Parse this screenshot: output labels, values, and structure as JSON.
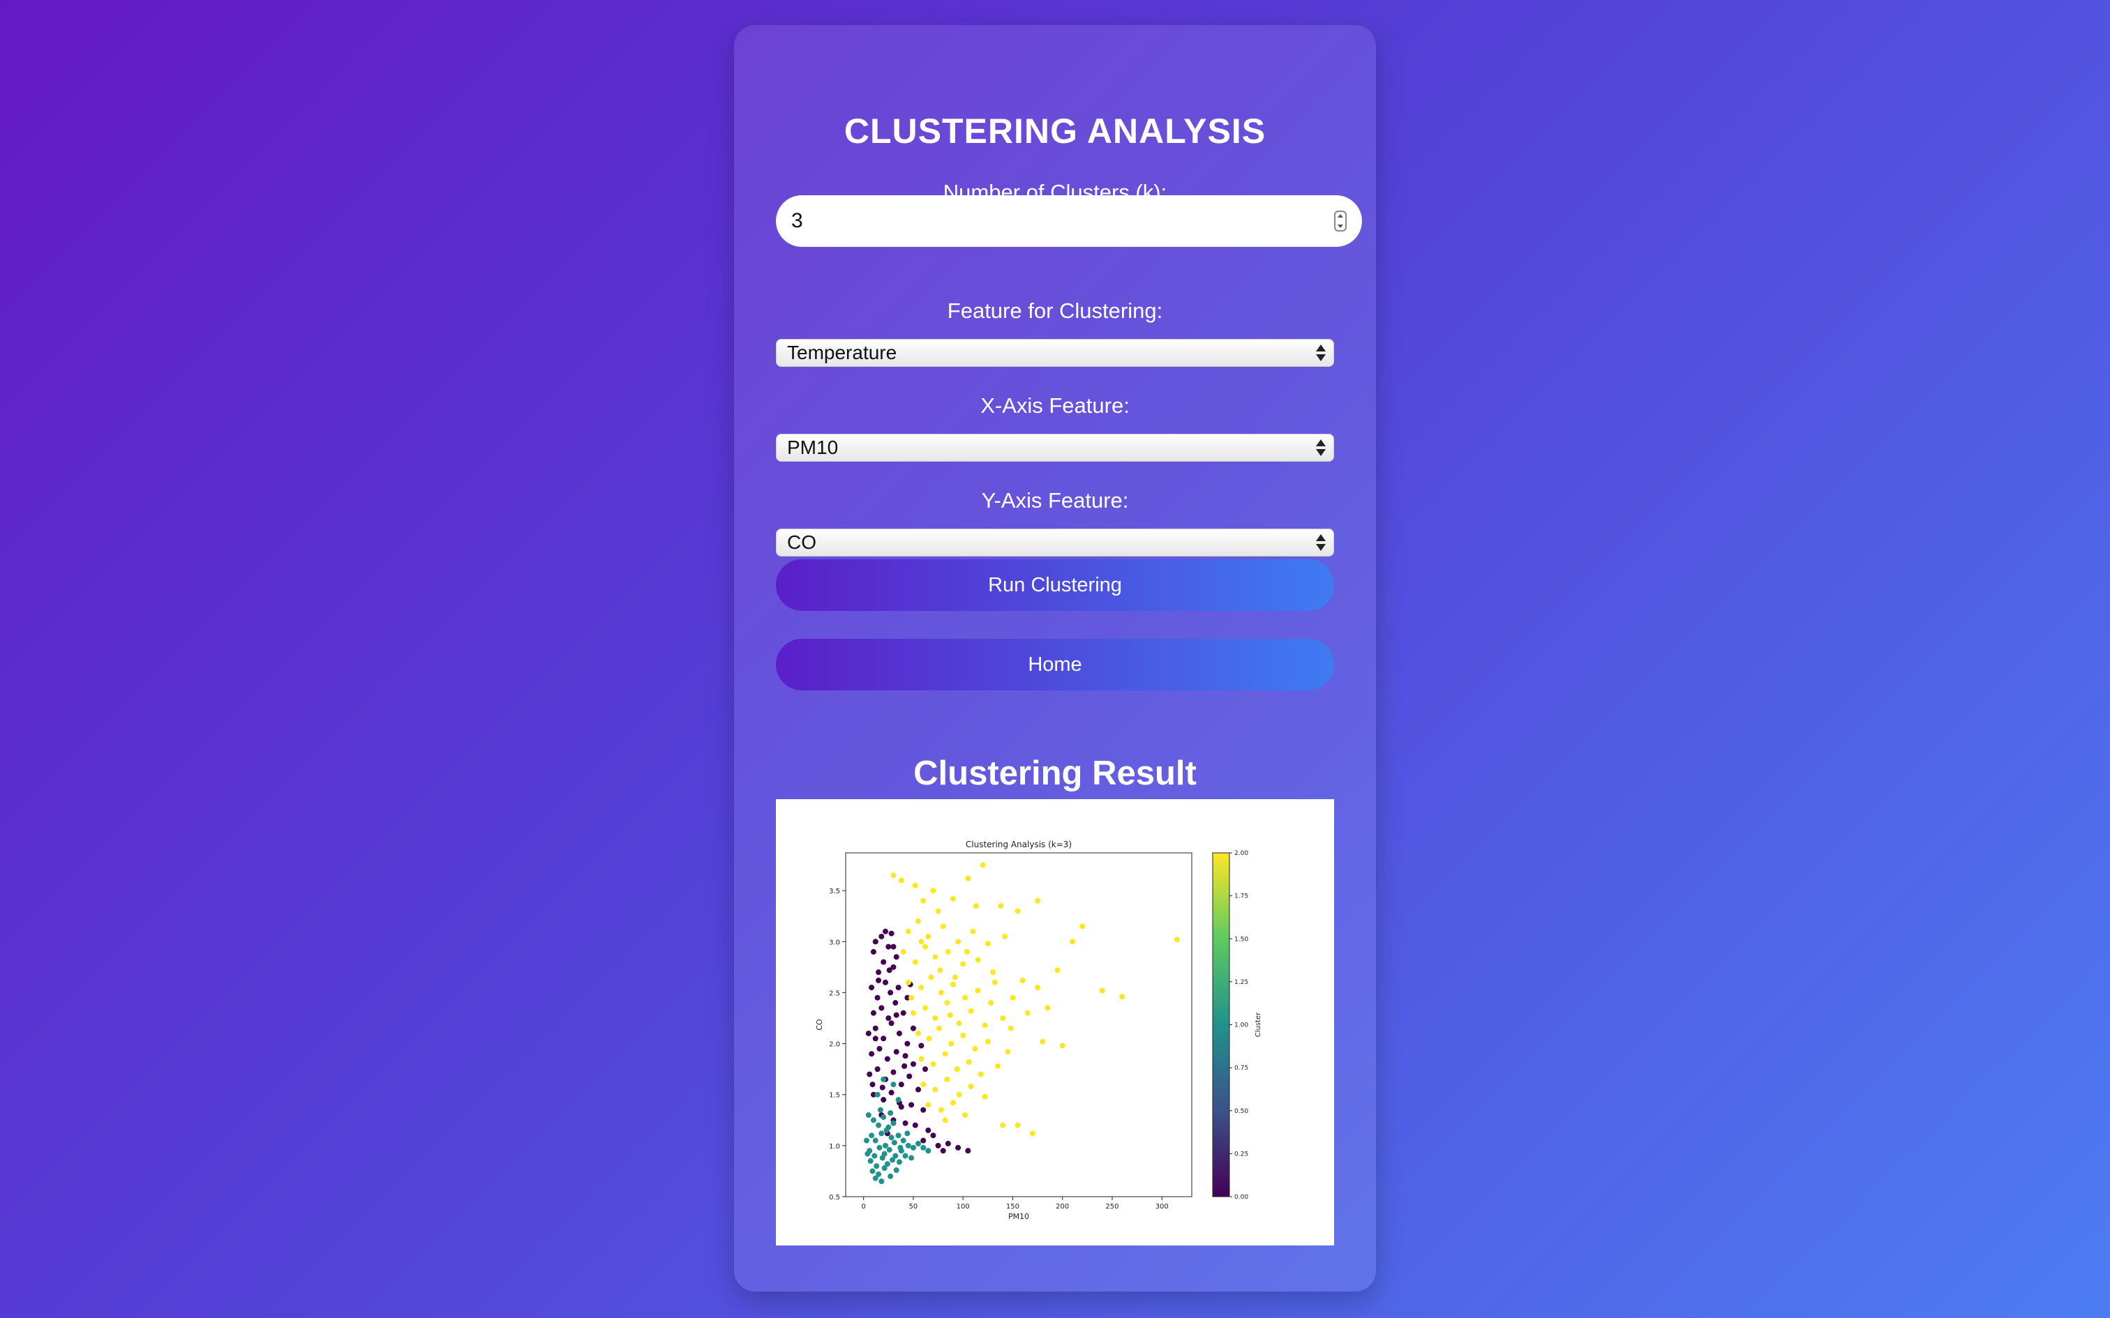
{
  "form": {
    "title": "CLUSTERING ANALYSIS",
    "k_label": "Number of Clusters (k):",
    "k_value": "3",
    "feature_label": "Feature for Clustering:",
    "feature_value": "Temperature",
    "x_label": "X-Axis Feature:",
    "x_value": "PM10",
    "y_label": "Y-Axis Feature:",
    "y_value": "CO",
    "run_button": "Run Clustering",
    "home_button": "Home"
  },
  "result": {
    "title": "Clustering Result"
  },
  "chart_data": {
    "type": "scatter",
    "title": "Clustering Analysis (k=3)",
    "xlabel": "PM10",
    "ylabel": "CO",
    "xlim": [
      -18,
      330
    ],
    "ylim": [
      0.5,
      3.87
    ],
    "xticks": [
      "0",
      "50",
      "100",
      "150",
      "200",
      "250",
      "300"
    ],
    "yticks": [
      "0.5",
      "1.0",
      "1.5",
      "2.0",
      "2.5",
      "3.0",
      "3.5"
    ],
    "grid": false,
    "colorbar": {
      "label": "Cluster",
      "ticks": [
        "0.00",
        "0.25",
        "0.50",
        "0.75",
        "1.00",
        "1.25",
        "1.50",
        "1.75",
        "2.00"
      ],
      "colormap": [
        "#440154",
        "#3b528b",
        "#21918c",
        "#5ec962",
        "#fde725"
      ]
    },
    "series": [
      {
        "cluster": 0,
        "color": "#440154",
        "points": [
          [
            10,
            2.9
          ],
          [
            12,
            3.0
          ],
          [
            18,
            3.05
          ],
          [
            22,
            3.1
          ],
          [
            25,
            2.95
          ],
          [
            28,
            3.08
          ],
          [
            15,
            2.7
          ],
          [
            20,
            2.8
          ],
          [
            30,
            2.75
          ],
          [
            8,
            2.55
          ],
          [
            14,
            2.45
          ],
          [
            22,
            2.6
          ],
          [
            27,
            2.5
          ],
          [
            35,
            2.55
          ],
          [
            10,
            2.3
          ],
          [
            18,
            2.35
          ],
          [
            25,
            2.25
          ],
          [
            32,
            2.4
          ],
          [
            40,
            2.3
          ],
          [
            5,
            2.1
          ],
          [
            12,
            2.15
          ],
          [
            20,
            2.05
          ],
          [
            28,
            2.2
          ],
          [
            36,
            2.1
          ],
          [
            44,
            2.0
          ],
          [
            8,
            1.9
          ],
          [
            16,
            1.95
          ],
          [
            24,
            1.85
          ],
          [
            33,
            1.92
          ],
          [
            42,
            1.88
          ],
          [
            50,
            1.8
          ],
          [
            6,
            1.7
          ],
          [
            14,
            1.75
          ],
          [
            22,
            1.65
          ],
          [
            30,
            1.72
          ],
          [
            38,
            1.6
          ],
          [
            46,
            1.68
          ],
          [
            55,
            1.55
          ],
          [
            10,
            1.5
          ],
          [
            20,
            1.45
          ],
          [
            28,
            1.52
          ],
          [
            36,
            1.42
          ],
          [
            48,
            1.4
          ],
          [
            60,
            1.35
          ],
          [
            18,
            1.3
          ],
          [
            30,
            1.25
          ],
          [
            42,
            1.22
          ],
          [
            52,
            1.2
          ],
          [
            65,
            1.15
          ],
          [
            75,
            1.0
          ],
          [
            80,
            0.95
          ],
          [
            95,
            0.98
          ],
          [
            105,
            0.95
          ],
          [
            60,
            1.05
          ],
          [
            70,
            1.1
          ],
          [
            15,
            2.62
          ],
          [
            26,
            2.72
          ],
          [
            33,
            2.85
          ],
          [
            12,
            2.05
          ],
          [
            44,
            2.45
          ],
          [
            50,
            2.15
          ],
          [
            58,
            1.98
          ],
          [
            62,
            1.75
          ],
          [
            38,
            1.38
          ],
          [
            24,
            1.12
          ],
          [
            85,
            1.02
          ],
          [
            9,
            1.6
          ],
          [
            19,
            1.57
          ],
          [
            41,
            1.78
          ],
          [
            33,
            2.28
          ],
          [
            47,
            2.58
          ],
          [
            30,
            2.95
          ]
        ]
      },
      {
        "cluster": 1,
        "color": "#21918c",
        "points": [
          [
            5,
            1.3
          ],
          [
            10,
            1.25
          ],
          [
            15,
            1.2
          ],
          [
            20,
            1.28
          ],
          [
            25,
            1.18
          ],
          [
            30,
            1.22
          ],
          [
            8,
            1.1
          ],
          [
            12,
            1.05
          ],
          [
            18,
            1.12
          ],
          [
            22,
            1.0
          ],
          [
            28,
            1.08
          ],
          [
            35,
            1.1
          ],
          [
            40,
            1.05
          ],
          [
            6,
            0.95
          ],
          [
            11,
            0.9
          ],
          [
            16,
            0.98
          ],
          [
            21,
            0.92
          ],
          [
            26,
            0.96
          ],
          [
            32,
            0.9
          ],
          [
            38,
            0.95
          ],
          [
            45,
            1.0
          ],
          [
            50,
            0.98
          ],
          [
            7,
            0.85
          ],
          [
            13,
            0.8
          ],
          [
            19,
            0.88
          ],
          [
            24,
            0.82
          ],
          [
            29,
            0.86
          ],
          [
            36,
            0.84
          ],
          [
            9,
            0.75
          ],
          [
            15,
            0.72
          ],
          [
            21,
            0.78
          ],
          [
            27,
            0.7
          ],
          [
            33,
            0.76
          ],
          [
            12,
            0.68
          ],
          [
            18,
            0.65
          ],
          [
            55,
            1.02
          ],
          [
            60,
            0.98
          ],
          [
            65,
            0.95
          ],
          [
            42,
            0.9
          ],
          [
            48,
            0.88
          ],
          [
            3,
            1.05
          ],
          [
            4,
            0.92
          ],
          [
            23,
            1.15
          ],
          [
            31,
            1.03
          ],
          [
            37,
            0.98
          ],
          [
            17,
            1.35
          ],
          [
            27,
            1.32
          ],
          [
            44,
            1.12
          ],
          [
            14,
            1.5
          ],
          [
            30,
            1.6
          ],
          [
            20,
            1.65
          ],
          [
            35,
            1.45
          ]
        ]
      },
      {
        "cluster": 2,
        "color": "#fde725",
        "points": [
          [
            30,
            3.65
          ],
          [
            38,
            3.6
          ],
          [
            52,
            3.55
          ],
          [
            70,
            3.5
          ],
          [
            105,
            3.62
          ],
          [
            120,
            3.75
          ],
          [
            60,
            3.4
          ],
          [
            75,
            3.3
          ],
          [
            90,
            3.42
          ],
          [
            113,
            3.35
          ],
          [
            138,
            3.35
          ],
          [
            155,
            3.3
          ],
          [
            175,
            3.4
          ],
          [
            220,
            3.15
          ],
          [
            315,
            3.02
          ],
          [
            45,
            3.1
          ],
          [
            55,
            3.2
          ],
          [
            65,
            3.05
          ],
          [
            80,
            3.15
          ],
          [
            95,
            3.0
          ],
          [
            110,
            3.1
          ],
          [
            125,
            2.98
          ],
          [
            142,
            3.05
          ],
          [
            210,
            3.0
          ],
          [
            40,
            2.9
          ],
          [
            52,
            2.8
          ],
          [
            62,
            2.95
          ],
          [
            72,
            2.85
          ],
          [
            85,
            2.9
          ],
          [
            100,
            2.78
          ],
          [
            115,
            2.82
          ],
          [
            130,
            2.7
          ],
          [
            160,
            2.62
          ],
          [
            195,
            2.72
          ],
          [
            45,
            2.6
          ],
          [
            58,
            2.55
          ],
          [
            68,
            2.65
          ],
          [
            78,
            2.5
          ],
          [
            90,
            2.58
          ],
          [
            102,
            2.45
          ],
          [
            115,
            2.52
          ],
          [
            128,
            2.4
          ],
          [
            150,
            2.45
          ],
          [
            175,
            2.55
          ],
          [
            240,
            2.52
          ],
          [
            260,
            2.46
          ],
          [
            50,
            2.3
          ],
          [
            62,
            2.35
          ],
          [
            72,
            2.25
          ],
          [
            84,
            2.4
          ],
          [
            96,
            2.2
          ],
          [
            108,
            2.32
          ],
          [
            122,
            2.18
          ],
          [
            140,
            2.25
          ],
          [
            165,
            2.3
          ],
          [
            185,
            2.35
          ],
          [
            55,
            2.1
          ],
          [
            66,
            2.05
          ],
          [
            76,
            2.15
          ],
          [
            88,
            2.0
          ],
          [
            100,
            2.08
          ],
          [
            112,
            1.95
          ],
          [
            125,
            2.02
          ],
          [
            145,
            1.92
          ],
          [
            180,
            2.02
          ],
          [
            200,
            1.98
          ],
          [
            58,
            1.85
          ],
          [
            70,
            1.8
          ],
          [
            82,
            1.9
          ],
          [
            94,
            1.75
          ],
          [
            106,
            1.82
          ],
          [
            118,
            1.7
          ],
          [
            135,
            1.78
          ],
          [
            60,
            1.6
          ],
          [
            72,
            1.55
          ],
          [
            84,
            1.65
          ],
          [
            96,
            1.5
          ],
          [
            108,
            1.58
          ],
          [
            122,
            1.48
          ],
          [
            65,
            1.4
          ],
          [
            78,
            1.35
          ],
          [
            90,
            1.42
          ],
          [
            102,
            1.3
          ],
          [
            155,
            1.2
          ],
          [
            170,
            1.12
          ],
          [
            140,
            1.2
          ],
          [
            82,
            1.25
          ],
          [
            48,
            2.45
          ],
          [
            58,
            3.0
          ],
          [
            92,
            2.65
          ],
          [
            104,
            2.9
          ],
          [
            132,
            2.6
          ],
          [
            148,
            2.15
          ],
          [
            77,
            2.72
          ],
          [
            87,
            2.28
          ]
        ]
      }
    ]
  }
}
